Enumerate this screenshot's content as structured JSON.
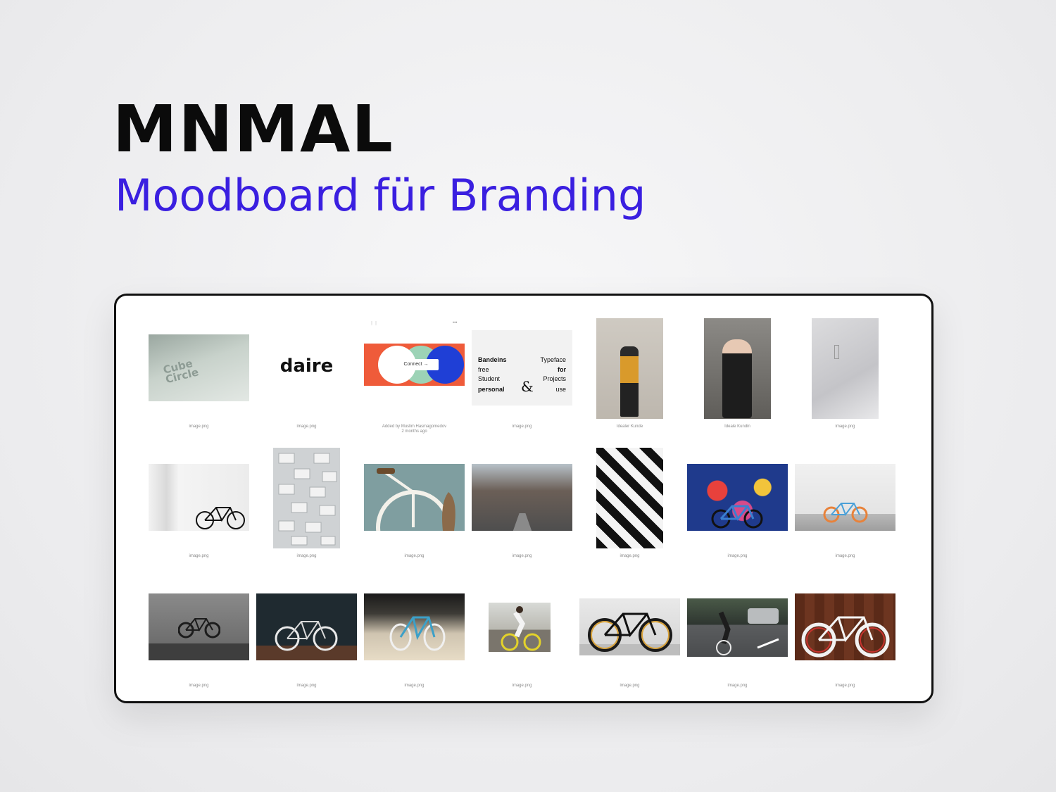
{
  "hero": {
    "title": "MNMAL",
    "subtitle": "Moodboard für Branding"
  },
  "colors": {
    "title": "#0b0b0b",
    "subtitle": "#3a1fe0",
    "board_border": "#111111"
  },
  "board": {
    "row1": [
      {
        "kind": "cube-card",
        "caption": "image.png",
        "text_lines": [
          "Cube",
          "Circle"
        ]
      },
      {
        "kind": "logo",
        "caption": "image.png",
        "logo_text": "daire"
      },
      {
        "kind": "connect-card",
        "caption": "Added by Muslim Hasmagomedov",
        "sub_caption": "2 months ago",
        "button_text": "Connect →"
      },
      {
        "kind": "typeface-card",
        "caption": "image.png",
        "left_words": [
          "Bandeins",
          "free",
          "Student",
          "personal"
        ],
        "right_words": [
          "Typeface",
          "for",
          "Projects",
          "use"
        ],
        "ampersand": "&"
      },
      {
        "kind": "photo",
        "caption": "Idealer Kunde"
      },
      {
        "kind": "photo",
        "caption": "Ideale Kundin"
      },
      {
        "kind": "photo",
        "caption": "image.png"
      }
    ],
    "row2": [
      {
        "kind": "photo",
        "caption": "image.png"
      },
      {
        "kind": "photo",
        "caption": "image.png"
      },
      {
        "kind": "photo",
        "caption": "image.png"
      },
      {
        "kind": "photo",
        "caption": "image.png"
      },
      {
        "kind": "photo",
        "caption": "image.png"
      },
      {
        "kind": "photo",
        "caption": "image.png"
      },
      {
        "kind": "photo",
        "caption": "image.png"
      }
    ],
    "row3": [
      {
        "kind": "photo",
        "caption": "image.png"
      },
      {
        "kind": "photo",
        "caption": "image.png"
      },
      {
        "kind": "photo",
        "caption": "image.png"
      },
      {
        "kind": "photo",
        "caption": "image.png"
      },
      {
        "kind": "photo",
        "caption": "image.png"
      },
      {
        "kind": "photo",
        "caption": "image.png"
      },
      {
        "kind": "photo",
        "caption": "image.png"
      }
    ]
  }
}
